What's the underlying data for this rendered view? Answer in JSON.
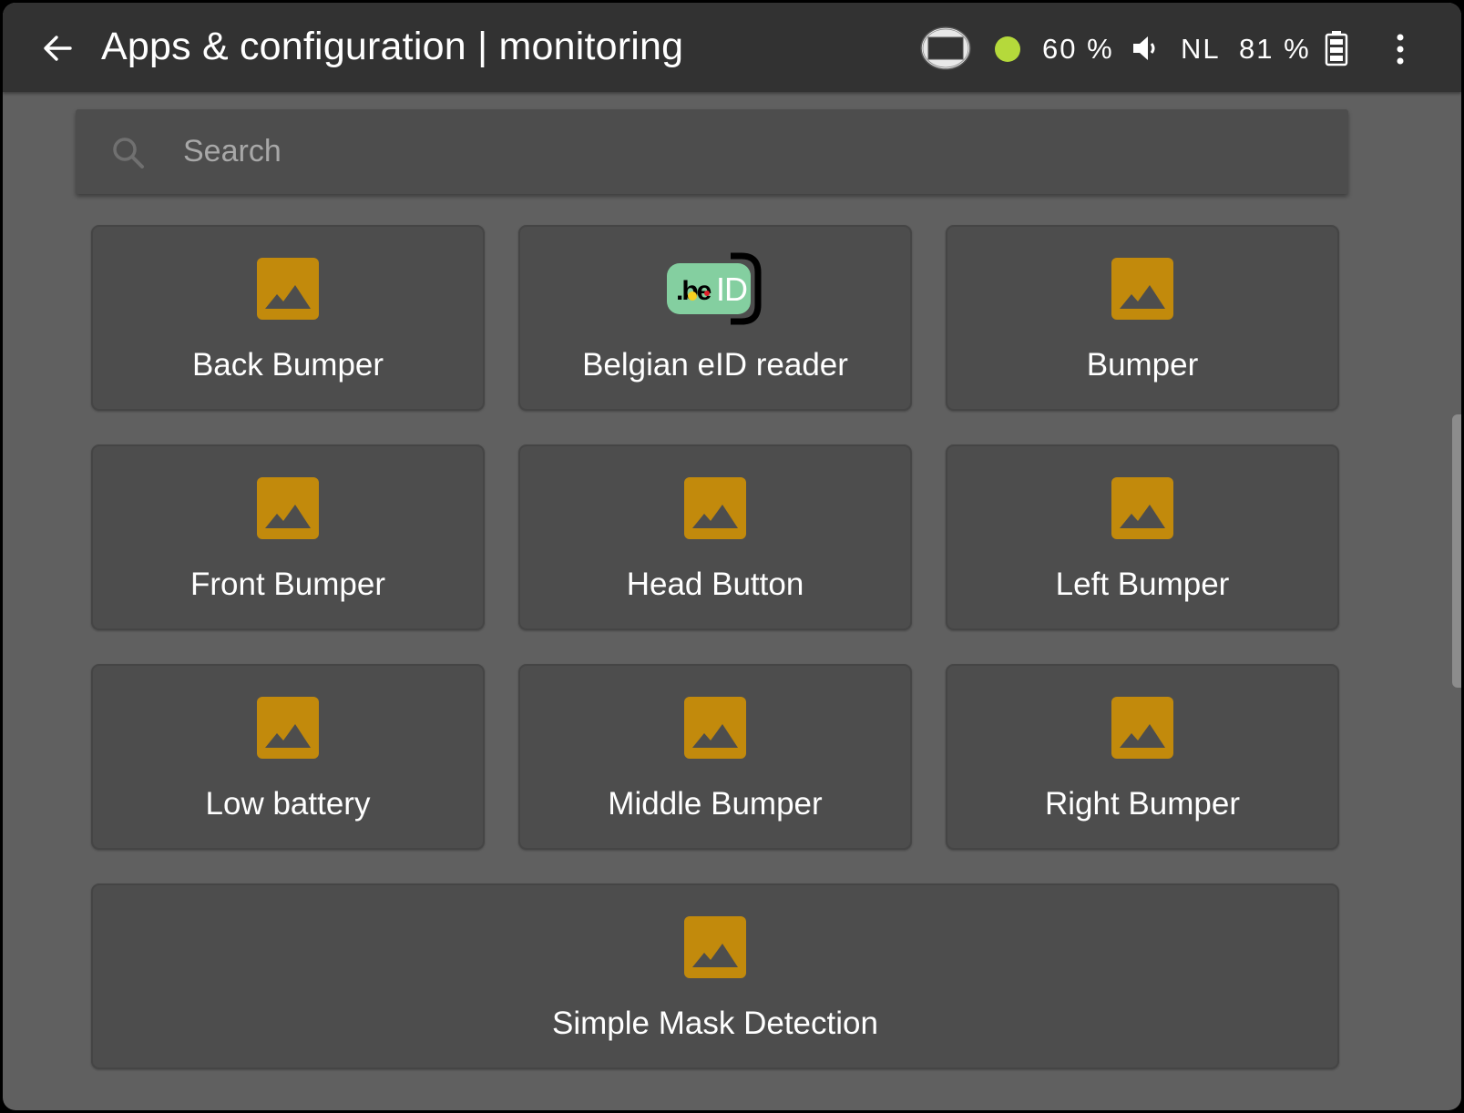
{
  "header": {
    "title": "Apps & configuration | monitoring",
    "back_icon": "arrow-left-icon"
  },
  "status_bar": {
    "screen_mirror_icon": "screen-mirror-icon",
    "wifi_status_color": "#b5d93b",
    "volume_percent": "60 %",
    "speaker_icon": "speaker-icon",
    "language": "NL",
    "battery_percent": "81 %",
    "battery_icon": "battery-icon",
    "more_icon": "more-vertical-icon"
  },
  "search": {
    "placeholder": "Search",
    "value": ""
  },
  "colors": {
    "accent": "#c28a0c",
    "background": "#606060",
    "card": "#4d4d4d",
    "topbar": "#323232"
  },
  "apps": [
    {
      "label": "Back Bumper",
      "icon": "image-placeholder-icon"
    },
    {
      "label": "Belgian eID reader",
      "icon": "beid-logo-icon"
    },
    {
      "label": "Bumper",
      "icon": "image-placeholder-icon"
    },
    {
      "label": "Front Bumper",
      "icon": "image-placeholder-icon"
    },
    {
      "label": "Head Button",
      "icon": "image-placeholder-icon"
    },
    {
      "label": "Left Bumper",
      "icon": "image-placeholder-icon"
    },
    {
      "label": "Low battery",
      "icon": "image-placeholder-icon"
    },
    {
      "label": "Middle Bumper",
      "icon": "image-placeholder-icon"
    },
    {
      "label": "Right Bumper",
      "icon": "image-placeholder-icon"
    },
    {
      "label": "Simple Mask Detection",
      "icon": "image-placeholder-icon"
    }
  ],
  "beid_logo": {
    "prefix": ".be",
    "suffix": "ID"
  }
}
